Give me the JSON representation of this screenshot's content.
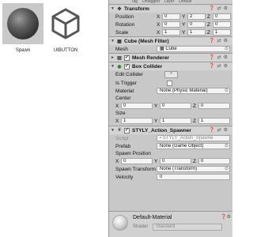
{
  "assets": [
    {
      "name": "Spawn"
    },
    {
      "name": "UIBUTTON"
    }
  ],
  "inspector": {
    "tag_row": {
      "tag_label": "Tag",
      "tag_value": "Untagged",
      "layer_label": "Layer",
      "layer_value": "Default"
    },
    "transform": {
      "title": "Transform",
      "position": {
        "label": "Position",
        "x": "0",
        "y": "2",
        "z": "0"
      },
      "rotation": {
        "label": "Rotation",
        "x": "0",
        "y": "0",
        "z": "0"
      },
      "scale": {
        "label": "Scale",
        "x": "1",
        "y": "1",
        "z": "1"
      }
    },
    "mesh_filter": {
      "title": "Cube (Mesh Filter)",
      "mesh_label": "Mesh",
      "mesh_value": "Cube"
    },
    "mesh_renderer": {
      "title": "Mesh Renderer"
    },
    "box_collider": {
      "title": "Box Collider",
      "edit_label": "Edit Collider",
      "trigger_label": "Is Trigger",
      "material_label": "Material",
      "material_value": "None (Physic Material)",
      "center_label": "Center",
      "center": {
        "x": "0",
        "y": "0",
        "z": "0"
      },
      "size_label": "Size",
      "size": {
        "x": "1",
        "y": "1",
        "z": "1"
      }
    },
    "spawner": {
      "title": "STYLY_Action_Spawner",
      "script_label": "Script",
      "script_value": "STYLY_Action_Spawne",
      "prefab_label": "Prefab",
      "prefab_value": "None (Game Object)",
      "spawn_position_label": "Spawn Position",
      "spawn_position": {
        "x": "0",
        "y": "0",
        "z": "0"
      },
      "spawn_transform_label": "Spawn Transform",
      "spawn_transform_value": "None (Transform)",
      "velocity_label": "Velocity",
      "velocity_value": "0"
    },
    "material": {
      "name": "Default-Material",
      "shader_label": "Shader",
      "shader_value": "Standard"
    }
  },
  "axes": {
    "x": "X",
    "y": "Y",
    "z": "Z"
  }
}
